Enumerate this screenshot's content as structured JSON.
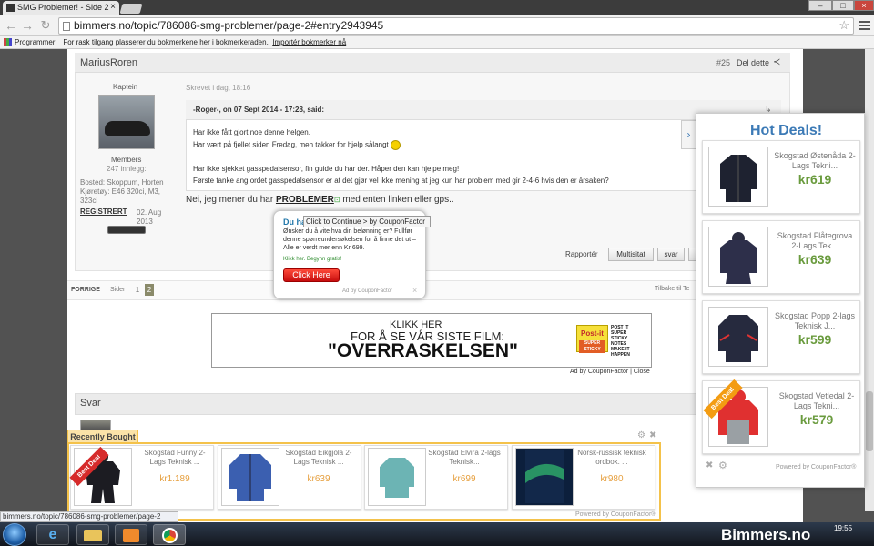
{
  "browser": {
    "tab_title": "SMG Problemer! - Side 2",
    "url": "bimmers.no/topic/786086-smg-problemer/page-2#entry2943945",
    "bookmarks": {
      "apps_label": "Programmer",
      "hint": "For rask tilgang plasserer du bokmerkene her i bokmerkeraden.",
      "import_link": "Importér bokmerker nå"
    },
    "status_url": "bimmers.no/topic/786086-smg-problemer/page-2"
  },
  "post": {
    "author": "MariusRoren",
    "post_number": "#25",
    "share_label": "Del dette",
    "rank": "Kaptein",
    "group": "Members",
    "post_count": "247 innlegg:",
    "location": "Bosted: Skoppum, Horten",
    "vehicle": "Kjøretøy: E46 320ci, M3, 323ci",
    "registered_label": "REGISTRERT",
    "registered_date": "02. Aug 2013",
    "timestamp": "Skrevet i dag, 18:16",
    "quote_header": "-Roger-, on 07 Sept 2014 - 17:28, said:",
    "quote_line1": "Har ikke fått gjort noe denne helgen.",
    "quote_line2": "Har vært på fjellet siden Fredag, men takker for hjelp sålangt",
    "quote_line3": "Har ikke sjekket gasspedalsensor, fin guide du har der. Håper den kan hjelpe meg!",
    "quote_line4": "Første tanke ang ordet gasspedalsensor er at det gjør vel ikke mening at jeg kun har problem med gir 2-4-6 hvis den er årsaken?",
    "reply_pre": "Nei, jeg mener du har ",
    "reply_link": "PROBLEMER",
    "reply_post": " med enten linken eller gps..",
    "report_label": "Rapportér",
    "multiquote_label": "Multisitat",
    "quote_btn_label": "svar"
  },
  "pagination": {
    "prev": "FORRIGE",
    "pages_label": "Sider",
    "page1": "1",
    "page2": "2",
    "back": "Tilbake til Te"
  },
  "film_ad": {
    "line1": "KLIKK HER",
    "line2": "FOR Å SE VÅR SISTE FILM:",
    "line3": "\"OVERRASKELSEN\"",
    "brand": "Post-it",
    "brand_sub": "SUPER STICKY",
    "tagline": "POST IT SUPER STICKY NOTES MAKE IT HAPPEN",
    "credit": "Ad by CouponFactor | Close"
  },
  "reply_box": {
    "title": "Svar"
  },
  "popup": {
    "title": "Du ha",
    "tooltip": "Click to Continue > by CouponFactor",
    "body": "Ønsker du å vite hva din belønning er? Fullfør denne spørreundersøkelsen for å finne det ut – Alle er verdt mer enn Kr 699.",
    "cta_text": "Klikk her. Begynn gratis!",
    "button": "Click Here",
    "footer": "Ad by CouponFactor"
  },
  "hot_deals": {
    "title": "Hot Deals!",
    "items": [
      {
        "name": "Skogstad Østenåda 2-Lags Tekni...",
        "price": "kr619"
      },
      {
        "name": "Skogstad Flåtegrova 2-Lags Tek...",
        "price": "kr639"
      },
      {
        "name": "Skogstad Popp 2-lags Teknisk J...",
        "price": "kr599"
      },
      {
        "name": "Skogstad Vetledal 2-Lags Tekni...",
        "price": "kr579"
      }
    ],
    "best_deal": "Best Deal",
    "powered": "Powered by CouponFactor®"
  },
  "recently_bought": {
    "title": "Recently Bought",
    "items": [
      {
        "name": "Skogstad Funny 2-Lags Teknisk ...",
        "price": "kr1.189"
      },
      {
        "name": "Skogstad Eikgjola 2-Lags Teknisk ...",
        "price": "kr639"
      },
      {
        "name": "Skogstad Elvira 2-lags Teknisk...",
        "price": "kr699"
      },
      {
        "name": "Norsk-russisk teknisk ordbok. ...",
        "price": "kr980"
      }
    ],
    "best_deal": "Best Deal",
    "powered": "Powered by CouponFactor®"
  },
  "taskbar": {
    "clock": "19:55",
    "watermark": "Bimmers.no"
  },
  "colors": {
    "accent_blue": "#3c7ab6",
    "deal_green": "#6a9b3e",
    "recent_orange": "#f4c24a",
    "button_red": "#d81f1f"
  }
}
